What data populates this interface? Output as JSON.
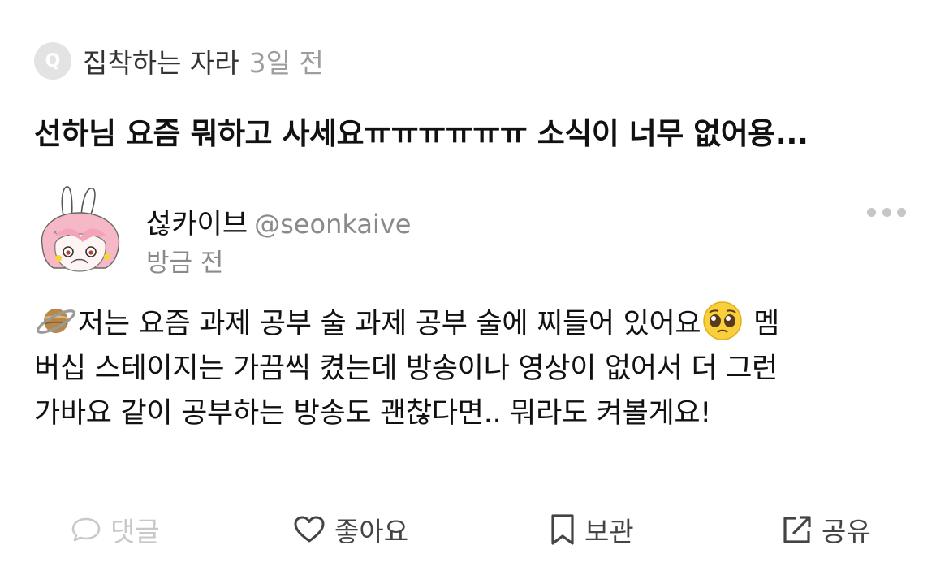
{
  "question": {
    "badge_letter": "Q",
    "author": "집착하는 자라",
    "time": "3일 전",
    "text": "선하님 요즘 뭐하고 사세요ㅠㅠㅠㅠㅠㅠ 소식이 너무 없어용..."
  },
  "answer": {
    "author_name": "섢카이브",
    "author_handle": "@seonkaive",
    "time": "방금 전",
    "lines": [
      {
        "before": "저는 요즘 과제 공부 술 과제 공부 술에 찌들어 있어요",
        "after": " 멤"
      },
      {
        "text": "버십 스테이지는 가끔씩 켰는데 방송이나 영상이 없어서 더 그런"
      },
      {
        "text": "가바요 같이 공부하는 방송도 괜찮다면.. 뭐라도 켜볼게요!"
      }
    ],
    "leading_emoji": "ringed-planet",
    "inline_emoji": "pleading-face"
  },
  "actions": {
    "comment_label": "댓글",
    "like_label": "좋아요",
    "save_label": "보관",
    "share_label": "공유"
  },
  "colors": {
    "muted_text": "#9e9e9e",
    "disabled_action": "#c8c8c8",
    "action_text": "#444444",
    "primary_text": "#111111"
  }
}
